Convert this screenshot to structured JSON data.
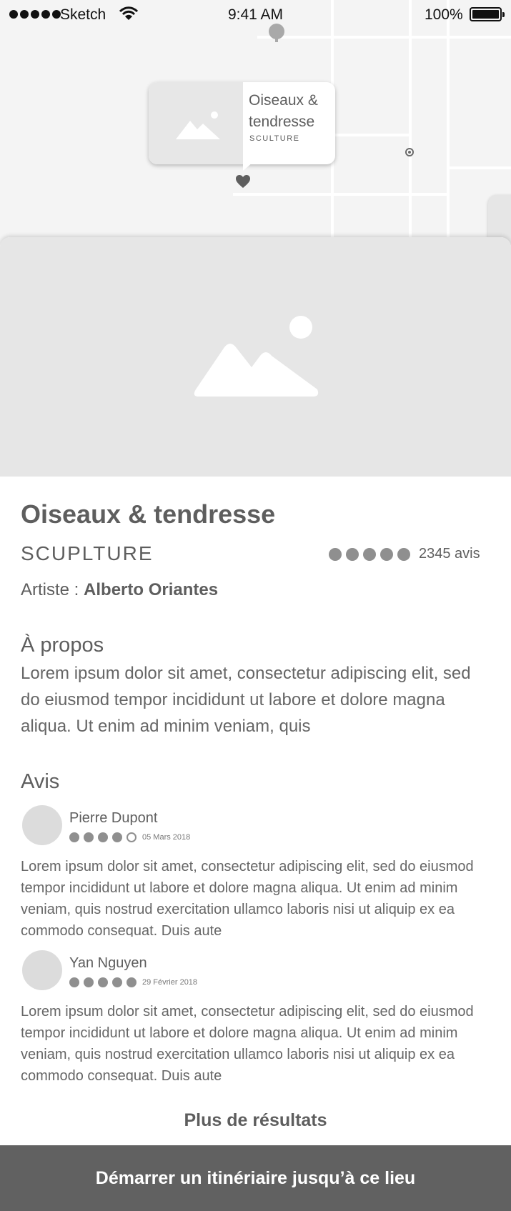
{
  "status_bar": {
    "carrier": "Sketch",
    "time": "9:41 AM",
    "battery": "100%",
    "icons": [
      "signal-icon",
      "wifi-icon",
      "battery-icon"
    ]
  },
  "map": {
    "popup": {
      "title": "Oiseaux & tendresse",
      "category": "SCULTURE"
    },
    "icons": [
      "image-placeholder-icon",
      "heart-icon",
      "location-pin-icon",
      "target-icon"
    ]
  },
  "detail": {
    "title": "Oiseaux & tendresse",
    "category": "SCUPLTURE",
    "rating": {
      "filled": 5,
      "total": 5,
      "count_label": "2345 avis"
    },
    "artist_label": "Artiste : ",
    "artist_name": "Alberto Oriantes",
    "about_title": "À propos",
    "about_text": "Lorem ipsum dolor sit amet, consectetur adipiscing elit, sed do eiusmod tempor incididunt ut labore et dolore magna aliqua. Ut enim ad minim veniam, quis",
    "reviews_title": "Avis",
    "reviews": [
      {
        "name": "Pierre Dupont",
        "rating": 4,
        "date": "05 Mars 2018",
        "text": "Lorem ipsum dolor sit amet, consectetur adipiscing elit, sed do eiusmod tempor incididunt ut labore et dolore magna aliqua. Ut enim ad minim veniam, quis nostrud exercitation ullamco laboris nisi ut aliquip ex ea commodo consequat. Duis aute"
      },
      {
        "name": "Yan Nguyen",
        "rating": 5,
        "date": "29 Février 2018",
        "text": "Lorem ipsum dolor sit amet, consectetur adipiscing elit, sed do eiusmod tempor incididunt ut labore et dolore magna aliqua. Ut enim ad minim veniam, quis nostrud exercitation ullamco laboris nisi ut aliquip ex ea commodo consequat. Duis aute"
      }
    ],
    "more_results": "Plus de résultats",
    "cta": "Démarrer un itinériaire jusqu’à ce lieu"
  },
  "colors": {
    "map_bg": "#f4f4f4",
    "placeholder": "#e6e6e6",
    "text": "#5e5e5e",
    "rating_dot": "#8f8f8f",
    "cta_bg": "#616161"
  }
}
